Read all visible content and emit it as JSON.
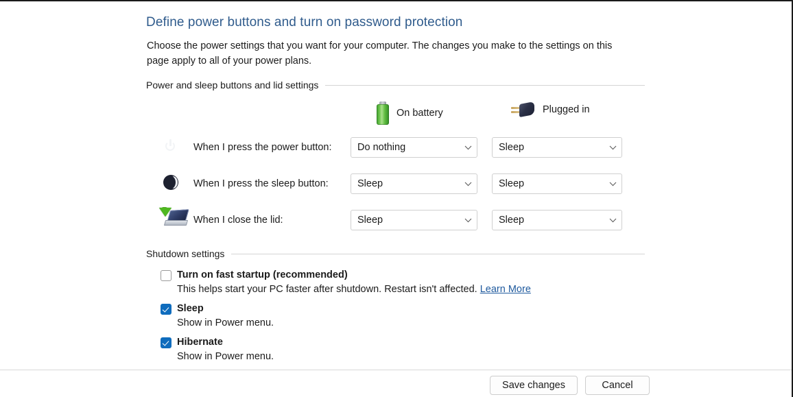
{
  "page": {
    "title": "Define power buttons and turn on password protection",
    "description": "Choose the power settings that you want for your computer. The changes you make to the settings on this page apply to all of your power plans."
  },
  "groups": {
    "power": {
      "label": "Power and sleep buttons and lid settings"
    },
    "shutdown": {
      "label": "Shutdown settings"
    }
  },
  "columns": [
    {
      "label": "On battery",
      "icon": "battery-icon"
    },
    {
      "label": "Plugged in",
      "icon": "power-plug-icon"
    }
  ],
  "rows": [
    {
      "icon": "power-button-icon",
      "label": "When I press the power button:",
      "on_battery": "Do nothing",
      "plugged_in": "Sleep"
    },
    {
      "icon": "sleep-button-icon",
      "label": "When I press the sleep button:",
      "on_battery": "Sleep",
      "plugged_in": "Sleep"
    },
    {
      "icon": "laptop-lid-icon",
      "label": "When I close the lid:",
      "on_battery": "Sleep",
      "plugged_in": "Sleep"
    }
  ],
  "checkboxes": [
    {
      "title": "Turn on fast startup (recommended)",
      "checked": false,
      "description": "This helps start your PC faster after shutdown. Restart isn't affected.",
      "link": "Learn More"
    },
    {
      "title": "Sleep",
      "checked": true,
      "description": "Show in Power menu.",
      "link": ""
    },
    {
      "title": "Hibernate",
      "checked": true,
      "description": "Show in Power menu.",
      "link": ""
    }
  ],
  "buttons": {
    "save": "Save changes",
    "cancel": "Cancel"
  },
  "colors": {
    "title": "#2f5b8c",
    "checkbox_checked": "#0f6cbd",
    "link": "#1f5a9e",
    "battery_green": "#63bf43"
  }
}
